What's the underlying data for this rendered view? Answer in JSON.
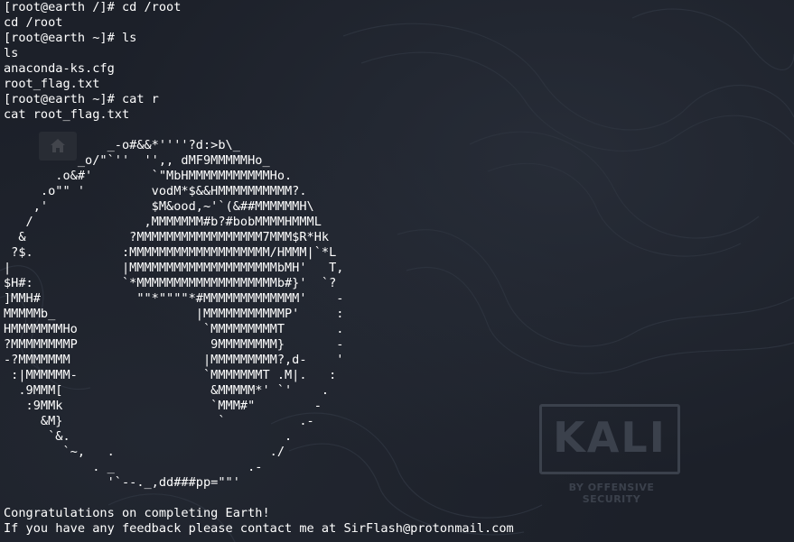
{
  "theme": {
    "background": "#1c2029",
    "foreground": "#ffffff",
    "watermark_color": "#3b414c"
  },
  "watermark": {
    "logo_text": "KALI",
    "subtitle": "BY OFFENSIVE SECURITY"
  },
  "terminal": {
    "lines": [
      "[root@earth /]# cd /root",
      "cd /root",
      "[root@earth ~]# ls",
      "ls",
      "anaconda-ks.cfg",
      "root_flag.txt",
      "[root@earth ~]# cat r",
      "cat root_flag.txt",
      "",
      "              _-o#&&*''''?d:>b\\_",
      "          _o/\"`''  '',, dMF9MMMMMHo_",
      "       .o&#'        `\"MbHMMMMMMMMMMMHo.",
      "     .o\"\" '         vodM*$&&HMMMMMMMMMM?.",
      "    ,'              $M&ood,~'`(&##MMMMMMH\\",
      "   /               ,MMMMMMM#b?#bobMMMMHMMML",
      "  &              ?MMMMMMMMMMMMMMMMM7MMM$R*Hk",
      " ?$.            :MMMMMMMMMMMMMMMMMMM/HMMM|`*L",
      "|               |MMMMMMMMMMMMMMMMMMMMbMH'   T,",
      "$H#:            `*MMMMMMMMMMMMMMMMMMMb#}'  `?",
      "]MMH#             \"\"*\"\"\"\"*#MMMMMMMMMMMMM'    -",
      "MMMMMb_                   |MMMMMMMMMMMP'     :",
      "HMMMMMMMHo                 `MMMMMMMMMT       .",
      "?MMMMMMMMP                  9MMMMMMMM}       -",
      "-?MMMMMMM                  |MMMMMMMMM?,d-    '",
      " :|MMMMMM-                 `MMMMMMMT .M|.   :",
      "  .9MMM[                    &MMMMM*' `'    .",
      "   :9MMk                    `MMM#\"        -",
      "     &M}                     `          .-",
      "      `&.                             .",
      "        `~,   .                     ./",
      "            . _                  .-",
      "              '`--._,dd###pp=\"\"'",
      "",
      "Congratulations on completing Earth!",
      "If you have any feedback please contact me at SirFlash@protonmail.com"
    ]
  }
}
